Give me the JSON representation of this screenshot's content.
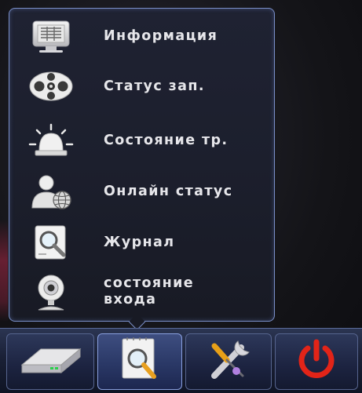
{
  "menu": {
    "items": [
      {
        "label": "Информация",
        "icon": "info-monitor-icon"
      },
      {
        "label": "Статус зап.",
        "icon": "film-reel-icon"
      },
      {
        "label": "Состояние тр.",
        "icon": "alarm-siren-icon"
      },
      {
        "label": "Онлайн статус",
        "icon": "online-user-globe-icon"
      },
      {
        "label": "Журнал",
        "icon": "log-magnifier-icon"
      },
      {
        "label": "состояние\nвхода",
        "icon": "webcam-icon"
      }
    ]
  },
  "taskbar": {
    "buttons": [
      {
        "icon": "hdd-icon",
        "active": false
      },
      {
        "icon": "search-log-icon",
        "active": true
      },
      {
        "icon": "tools-icon",
        "active": false
      },
      {
        "icon": "power-icon",
        "active": false
      }
    ]
  }
}
